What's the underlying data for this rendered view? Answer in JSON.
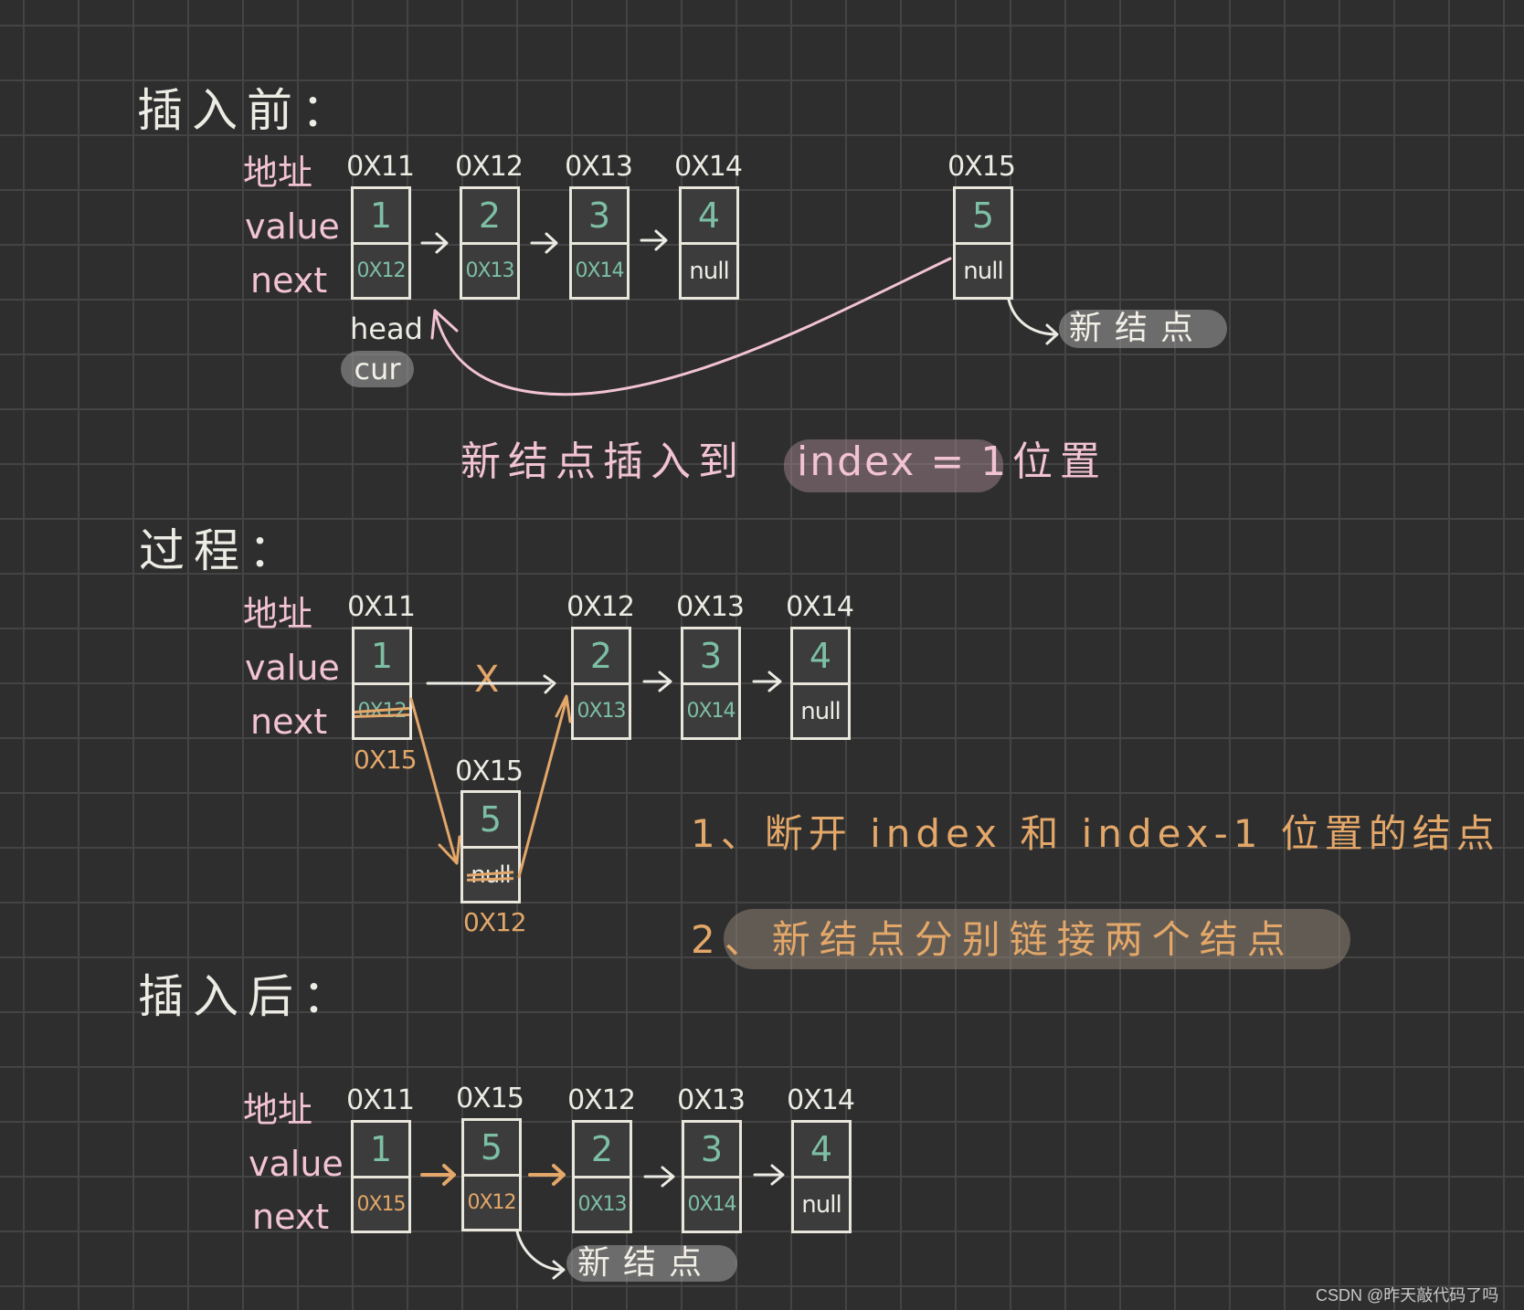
{
  "sections": {
    "before": {
      "title": "插入前：",
      "row_labels": {
        "address": "地址",
        "value": "value",
        "next": "next"
      },
      "nodes": [
        {
          "address": "0X11",
          "value": "1",
          "next": "0X12"
        },
        {
          "address": "0X12",
          "value": "2",
          "next": "0X13"
        },
        {
          "address": "0X13",
          "value": "3",
          "next": "0X14"
        },
        {
          "address": "0X14",
          "value": "4",
          "next": "null"
        }
      ],
      "new_node": {
        "address": "0X15",
        "value": "5",
        "next": "null"
      },
      "head_label": "head",
      "cur_label": "cur",
      "new_node_tag": "新结点",
      "caption_prefix": "新结点插入到",
      "caption_highlight": "index = 1",
      "caption_suffix": "位置"
    },
    "process": {
      "title": "过程：",
      "row_labels": {
        "address": "地址",
        "value": "value",
        "next": "next"
      },
      "nodes": [
        {
          "address": "0X11",
          "value": "1",
          "next_old": "0X12",
          "next_new": "0X15"
        },
        {
          "address": "0X12",
          "value": "2",
          "next": "0X13"
        },
        {
          "address": "0X13",
          "value": "3",
          "next": "0X14"
        },
        {
          "address": "0X14",
          "value": "4",
          "next": "null"
        }
      ],
      "new_node": {
        "address": "0X15",
        "value": "5",
        "next_old": "null",
        "next_new": "0X12"
      },
      "broken_link_mark": "X",
      "steps": [
        "1、断开 index 和 index-1 位置的结点",
        "2、新结点分别链接两个结点"
      ]
    },
    "after": {
      "title": "插入后：",
      "row_labels": {
        "address": "地址",
        "value": "value",
        "next": "next"
      },
      "nodes": [
        {
          "address": "0X11",
          "value": "1",
          "next": "0X15",
          "highlight": true
        },
        {
          "address": "0X15",
          "value": "5",
          "next": "0X12",
          "highlight": true
        },
        {
          "address": "0X12",
          "value": "2",
          "next": "0X13"
        },
        {
          "address": "0X13",
          "value": "3",
          "next": "0X14"
        },
        {
          "address": "0X14",
          "value": "4",
          "next": "null"
        }
      ],
      "new_node_tag": "新结点"
    }
  },
  "colors": {
    "background": "#2e2e2e",
    "grid": "#444444",
    "box_stroke": "#e9e7dc",
    "value_text": "#7dbfa5",
    "label_pink": "#f2c3d3",
    "accent_orange": "#e3a769",
    "text_white": "#ecebe4"
  },
  "watermark": "CSDN @昨天敲代码了吗"
}
